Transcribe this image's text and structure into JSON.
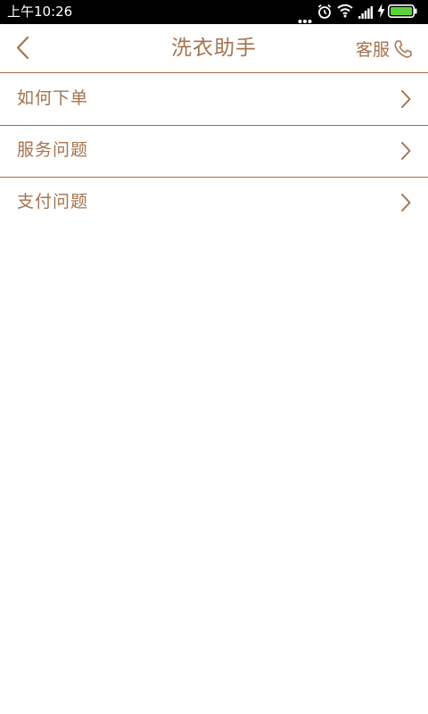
{
  "status_bar": {
    "time": "上午10:26",
    "icons": [
      "more-dots-icon",
      "alarm-icon",
      "wifi-icon",
      "signal-icon",
      "charging-icon",
      "battery-icon"
    ]
  },
  "header": {
    "title": "洗衣助手",
    "service_label": "客服"
  },
  "menu": {
    "items": [
      {
        "label": "如何下单"
      },
      {
        "label": "服务问题"
      },
      {
        "label": "支付问题"
      }
    ]
  },
  "colors": {
    "accent": "#a5734e",
    "divider": "#a56b47",
    "battery": "#5cd13b",
    "status_bar_bg": "#000000"
  }
}
